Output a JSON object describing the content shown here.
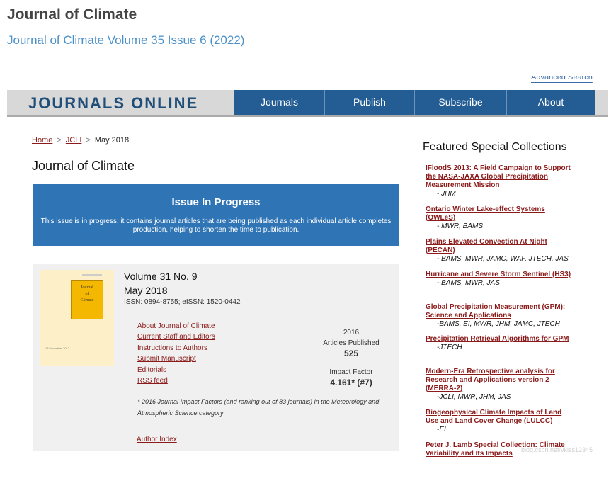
{
  "page": {
    "title": "Journal of Climate",
    "subtitle": "Journal of Climate Volume 35 Issue 6 (2022)"
  },
  "header": {
    "advanced_search": "Advanced Search",
    "brand": "JOURNALS ONLINE",
    "nav": [
      "Journals",
      "Publish",
      "Subscribe",
      "About"
    ]
  },
  "breadcrumb": {
    "home": "Home",
    "sep": ">",
    "journal": "JCLI",
    "current": "May 2018"
  },
  "main": {
    "heading": "Journal of Climate",
    "banner": {
      "title": "Issue In Progress",
      "text": "This issue is in progress; it contains journal articles that are being published as each individual article completes production, helping to shorten the time to publication."
    },
    "issue": {
      "volume": "Volume 31 No. 9",
      "month": "May 2018",
      "issn": "ISSN: 0894-8755; eISSN: 1520-0442",
      "cover": {
        "line1": "Journal",
        "line2": "of",
        "line3": "Climate",
        "date": "15 December 2017"
      },
      "links": [
        "About Journal of Climate",
        "Current Staff and Editors",
        "Instructions to Authors",
        "Submit Manuscript",
        "Editorials",
        "RSS feed"
      ],
      "stats": {
        "year": "2016",
        "articles_label": "Articles Published",
        "articles_value": "525",
        "impact_label": "Impact Factor",
        "impact_value": "4.161* (#7)"
      },
      "note": "* 2016 Journal Impact Factors (and ranking out of 83 journals) in the Meteorology and Atmospheric Science category",
      "author_index": "Author Index"
    }
  },
  "sidebar": {
    "title": "Featured Special Collections",
    "items": [
      {
        "title": "IFloodS 2013: A Field Campaign to Support the NASA-JAXA Global Precipitation Measurement Mission",
        "journals": "- JHM"
      },
      {
        "title": "Ontario Winter Lake-effect Systems (OWLeS)",
        "journals": "- MWR, BAMS"
      },
      {
        "title": "Plains Elevated Convection At Night (PECAN)",
        "journals": "- BAMS, MWR, JAMC, WAF, JTECH, JAS"
      },
      {
        "title": "Hurricane and Severe Storm Sentinel (HS3)",
        "journals": "- BAMS, MWR, JAS"
      },
      {
        "title": "Global Precipitation Measurement (GPM): Science and Applications",
        "journals": "-BAMS, EI, MWR, JHM, JAMC, JTECH"
      },
      {
        "title": "Precipitation Retrieval Algorithms for GPM",
        "journals": "-JTECH"
      },
      {
        "title": "Modern-Era Retrospective analysis for Research and Applications version 2 (MERRA-2)",
        "journals": "-JCLI, MWR, JHM, JAS"
      },
      {
        "title": "Biogeophysical Climate Impacts of Land Use and Land Cover Change (LULCC)",
        "journals": "-EI"
      },
      {
        "title": "Peter J. Lamb Special Collection: Climate Variability and Its Impacts",
        "journals": ""
      }
    ]
  },
  "watermark": "blog.csdn.net/vkiss12345"
}
